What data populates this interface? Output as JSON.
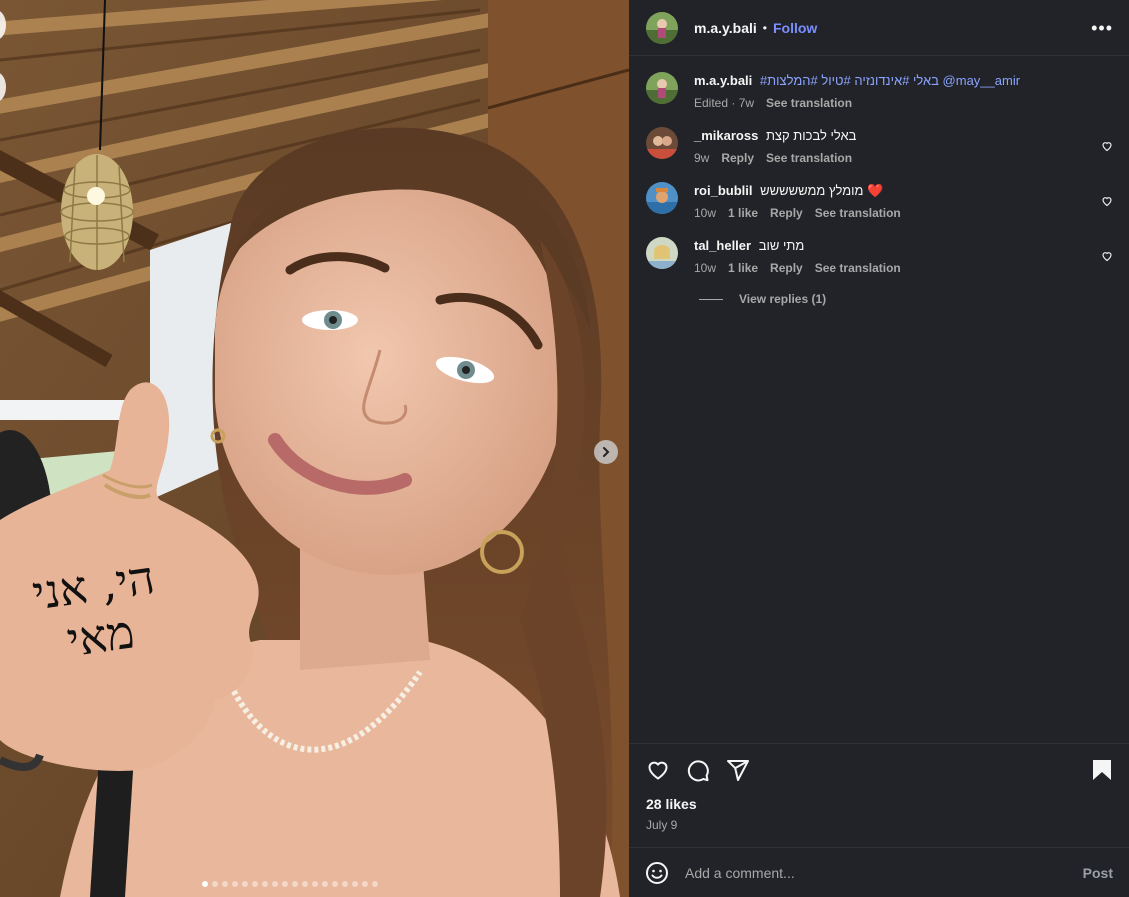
{
  "post": {
    "username": "m.a.y.bali",
    "follow_label": "Follow",
    "separator": "•",
    "more_label": "•••",
    "caption": {
      "username": "m.a.y.bali",
      "text": "#באלי #אינדונזיה #טיול #המלצות @may__amir",
      "edited": "Edited · 7w",
      "see_translation": "See translation"
    },
    "comments": [
      {
        "username": "_mikaross",
        "text": "באלי לבכות קצת",
        "time": "9w",
        "likes": "",
        "reply": "Reply",
        "see_translation": "See translation"
      },
      {
        "username": "roi_bublil",
        "text": "מומלץ ממששששש ❤️",
        "time": "10w",
        "likes": "1 like",
        "reply": "Reply",
        "see_translation": "See translation"
      },
      {
        "username": "tal_heller",
        "text": "מתי שוב",
        "time": "10w",
        "likes": "1 like",
        "reply": "Reply",
        "see_translation": "See translation"
      }
    ],
    "view_replies": "View replies (1)",
    "likes": "28 likes",
    "date": "July 9",
    "add_comment_placeholder": "Add a comment...",
    "post_button": "Post",
    "carousel": {
      "total_slides": 18,
      "current_slide": 1
    },
    "hand_text": "הי, אני מאי"
  },
  "icons": {
    "more": "more-options-icon",
    "like": "heart-icon",
    "comment": "comment-icon",
    "share": "share-icon",
    "save": "bookmark-icon",
    "emoji": "emoji-icon",
    "next": "chevron-right-icon"
  },
  "colors": {
    "panel_bg": "#212328",
    "follow": "#7a8fff",
    "hashtag": "#8aa4ff",
    "muted": "#a8a8a8"
  }
}
